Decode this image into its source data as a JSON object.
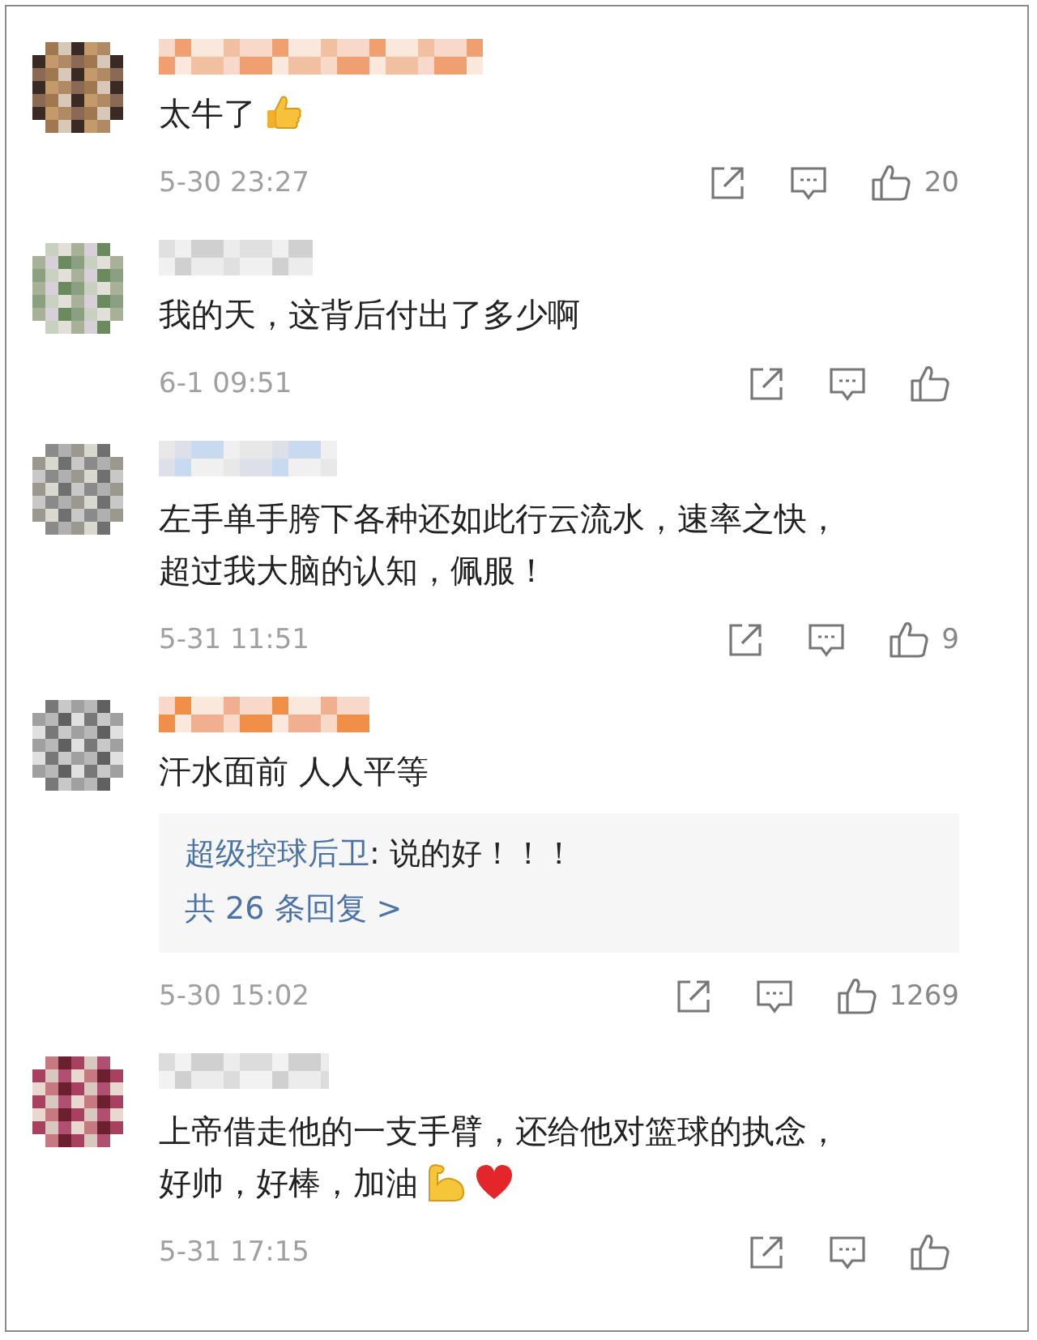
{
  "comments": [
    {
      "lines": [
        "太牛了"
      ],
      "icons": [
        {
          "kind": "thumbs-up"
        }
      ],
      "time": "5-30 23:27",
      "likes": "20"
    },
    {
      "lines": [
        "我的天，这背后付出了多少啊"
      ],
      "time": "6-1 09:51"
    },
    {
      "lines": [
        "左手单手胯下各种还如此行云流水，速率之快，",
        "超过我大脑的认知，佩服！"
      ],
      "time": "5-31 11:51",
      "likes": "9"
    },
    {
      "lines": [
        "汗水面前 人人平等"
      ],
      "reply": {
        "author": "超级控球后卫",
        "text": ": 说的好！！！",
        "more": "共 26 条回复 >"
      },
      "time": "5-30 15:02",
      "likes": "1269"
    },
    {
      "lines": [
        "上帝借走他的一支手臂，还给他对篮球的执念，",
        "好帅，好棒，加油"
      ],
      "icons": [
        {
          "kind": "flexed-arm"
        },
        {
          "kind": "heart"
        }
      ],
      "time": "5-31 17:15"
    }
  ]
}
